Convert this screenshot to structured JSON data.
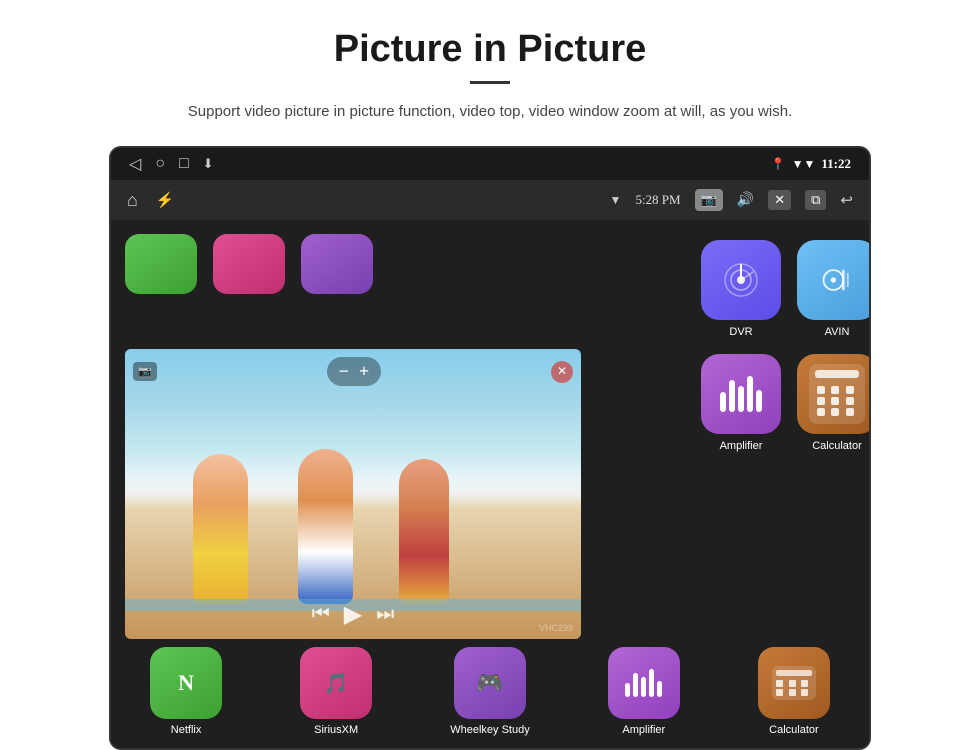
{
  "header": {
    "title": "Picture in Picture",
    "subtitle": "Support video picture in picture function, video top, video window zoom at will, as you wish."
  },
  "status_bar": {
    "back_icon": "◁",
    "home_icon": "○",
    "square_icon": "□",
    "download_icon": "⬇",
    "time": "11:22",
    "signal_icon": "▼",
    "wifi_icon": "▼"
  },
  "toolbar": {
    "home_icon": "⌂",
    "usb_icon": "⚡",
    "wifi_icon": "▼",
    "time": "5:28 PM",
    "camera_icon": "📷",
    "volume_icon": "🔊",
    "close_icon": "✕",
    "pip_icon": "⧉",
    "back_icon": "↩"
  },
  "pip": {
    "zoom_minus": "−",
    "zoom_plus": "+",
    "prev_icon": "⏮",
    "play_icon": "▶",
    "next_icon": "⏭",
    "watermark": "VHC299"
  },
  "top_apps": [
    {
      "color": "#5dc554",
      "id": "netflix"
    },
    {
      "color": "#e05090",
      "id": "siriusxm"
    },
    {
      "color": "#a060d0",
      "id": "wheelkey"
    }
  ],
  "right_apps": [
    {
      "id": "dvr",
      "label": "DVR",
      "color_class": "icon-dvr",
      "icon_type": "dvr"
    },
    {
      "id": "avin",
      "label": "AVIN",
      "color_class": "icon-avin",
      "icon_type": "avin"
    },
    {
      "id": "amplifier",
      "label": "Amplifier",
      "color_class": "icon-amplifier",
      "icon_type": "amplifier"
    },
    {
      "id": "calculator",
      "label": "Calculator",
      "color_class": "icon-calculator",
      "icon_type": "calculator"
    }
  ],
  "bottom_apps": [
    {
      "id": "netflix",
      "label": "Netflix",
      "color": "#5dc554"
    },
    {
      "id": "siriusxm",
      "label": "SiriusXM",
      "color": "#e05090"
    },
    {
      "id": "wheelkey",
      "label": "Wheelkey Study",
      "color": "#a060d0"
    },
    {
      "id": "amplifier",
      "label": "Amplifier",
      "color": "#b366d4"
    },
    {
      "id": "calculator",
      "label": "Calculator",
      "color": "#c47a3a"
    }
  ]
}
